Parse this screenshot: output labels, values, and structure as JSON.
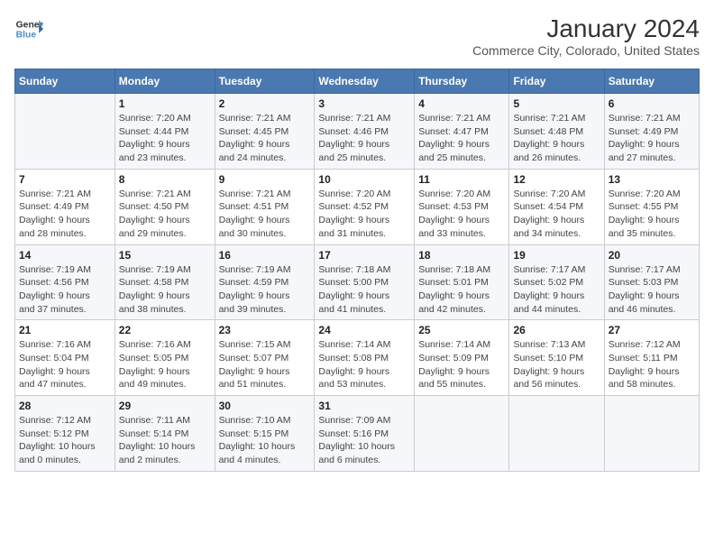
{
  "logo": {
    "line1": "General",
    "line2": "Blue"
  },
  "title": "January 2024",
  "subtitle": "Commerce City, Colorado, United States",
  "days_of_week": [
    "Sunday",
    "Monday",
    "Tuesday",
    "Wednesday",
    "Thursday",
    "Friday",
    "Saturday"
  ],
  "weeks": [
    [
      {
        "num": "",
        "info": ""
      },
      {
        "num": "1",
        "info": "Sunrise: 7:20 AM\nSunset: 4:44 PM\nDaylight: 9 hours\nand 23 minutes."
      },
      {
        "num": "2",
        "info": "Sunrise: 7:21 AM\nSunset: 4:45 PM\nDaylight: 9 hours\nand 24 minutes."
      },
      {
        "num": "3",
        "info": "Sunrise: 7:21 AM\nSunset: 4:46 PM\nDaylight: 9 hours\nand 25 minutes."
      },
      {
        "num": "4",
        "info": "Sunrise: 7:21 AM\nSunset: 4:47 PM\nDaylight: 9 hours\nand 25 minutes."
      },
      {
        "num": "5",
        "info": "Sunrise: 7:21 AM\nSunset: 4:48 PM\nDaylight: 9 hours\nand 26 minutes."
      },
      {
        "num": "6",
        "info": "Sunrise: 7:21 AM\nSunset: 4:49 PM\nDaylight: 9 hours\nand 27 minutes."
      }
    ],
    [
      {
        "num": "7",
        "info": "Sunrise: 7:21 AM\nSunset: 4:49 PM\nDaylight: 9 hours\nand 28 minutes."
      },
      {
        "num": "8",
        "info": "Sunrise: 7:21 AM\nSunset: 4:50 PM\nDaylight: 9 hours\nand 29 minutes."
      },
      {
        "num": "9",
        "info": "Sunrise: 7:21 AM\nSunset: 4:51 PM\nDaylight: 9 hours\nand 30 minutes."
      },
      {
        "num": "10",
        "info": "Sunrise: 7:20 AM\nSunset: 4:52 PM\nDaylight: 9 hours\nand 31 minutes."
      },
      {
        "num": "11",
        "info": "Sunrise: 7:20 AM\nSunset: 4:53 PM\nDaylight: 9 hours\nand 33 minutes."
      },
      {
        "num": "12",
        "info": "Sunrise: 7:20 AM\nSunset: 4:54 PM\nDaylight: 9 hours\nand 34 minutes."
      },
      {
        "num": "13",
        "info": "Sunrise: 7:20 AM\nSunset: 4:55 PM\nDaylight: 9 hours\nand 35 minutes."
      }
    ],
    [
      {
        "num": "14",
        "info": "Sunrise: 7:19 AM\nSunset: 4:56 PM\nDaylight: 9 hours\nand 37 minutes."
      },
      {
        "num": "15",
        "info": "Sunrise: 7:19 AM\nSunset: 4:58 PM\nDaylight: 9 hours\nand 38 minutes."
      },
      {
        "num": "16",
        "info": "Sunrise: 7:19 AM\nSunset: 4:59 PM\nDaylight: 9 hours\nand 39 minutes."
      },
      {
        "num": "17",
        "info": "Sunrise: 7:18 AM\nSunset: 5:00 PM\nDaylight: 9 hours\nand 41 minutes."
      },
      {
        "num": "18",
        "info": "Sunrise: 7:18 AM\nSunset: 5:01 PM\nDaylight: 9 hours\nand 42 minutes."
      },
      {
        "num": "19",
        "info": "Sunrise: 7:17 AM\nSunset: 5:02 PM\nDaylight: 9 hours\nand 44 minutes."
      },
      {
        "num": "20",
        "info": "Sunrise: 7:17 AM\nSunset: 5:03 PM\nDaylight: 9 hours\nand 46 minutes."
      }
    ],
    [
      {
        "num": "21",
        "info": "Sunrise: 7:16 AM\nSunset: 5:04 PM\nDaylight: 9 hours\nand 47 minutes."
      },
      {
        "num": "22",
        "info": "Sunrise: 7:16 AM\nSunset: 5:05 PM\nDaylight: 9 hours\nand 49 minutes."
      },
      {
        "num": "23",
        "info": "Sunrise: 7:15 AM\nSunset: 5:07 PM\nDaylight: 9 hours\nand 51 minutes."
      },
      {
        "num": "24",
        "info": "Sunrise: 7:14 AM\nSunset: 5:08 PM\nDaylight: 9 hours\nand 53 minutes."
      },
      {
        "num": "25",
        "info": "Sunrise: 7:14 AM\nSunset: 5:09 PM\nDaylight: 9 hours\nand 55 minutes."
      },
      {
        "num": "26",
        "info": "Sunrise: 7:13 AM\nSunset: 5:10 PM\nDaylight: 9 hours\nand 56 minutes."
      },
      {
        "num": "27",
        "info": "Sunrise: 7:12 AM\nSunset: 5:11 PM\nDaylight: 9 hours\nand 58 minutes."
      }
    ],
    [
      {
        "num": "28",
        "info": "Sunrise: 7:12 AM\nSunset: 5:12 PM\nDaylight: 10 hours\nand 0 minutes."
      },
      {
        "num": "29",
        "info": "Sunrise: 7:11 AM\nSunset: 5:14 PM\nDaylight: 10 hours\nand 2 minutes."
      },
      {
        "num": "30",
        "info": "Sunrise: 7:10 AM\nSunset: 5:15 PM\nDaylight: 10 hours\nand 4 minutes."
      },
      {
        "num": "31",
        "info": "Sunrise: 7:09 AM\nSunset: 5:16 PM\nDaylight: 10 hours\nand 6 minutes."
      },
      {
        "num": "",
        "info": ""
      },
      {
        "num": "",
        "info": ""
      },
      {
        "num": "",
        "info": ""
      }
    ]
  ]
}
